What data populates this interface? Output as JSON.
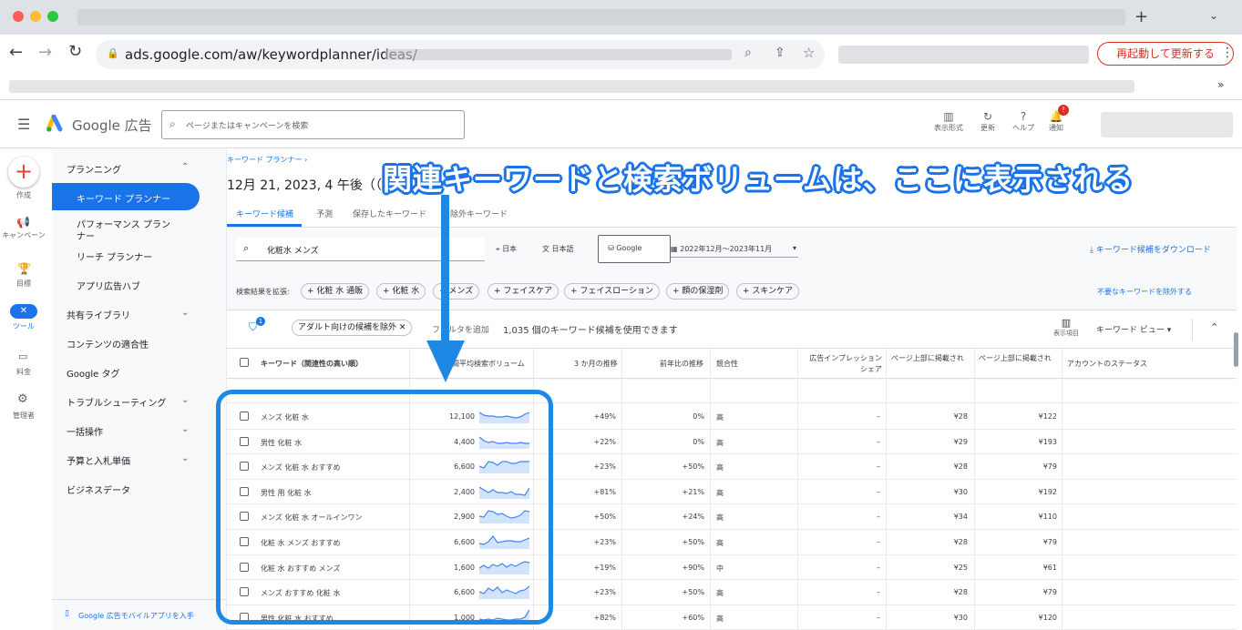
{
  "browser": {
    "url": "ads.google.com/aw/keywordplanner/ideas/",
    "restart_label": "再起動して更新する"
  },
  "app": {
    "brand": "Google 広告",
    "search_placeholder": "ページまたはキャンペーンを検索",
    "header_actions": [
      "表示形式",
      "更新",
      "ヘルプ",
      "通知"
    ],
    "notification_badge": "!"
  },
  "rail": {
    "items": [
      "作成",
      "キャンペーン",
      "目標",
      "ツール",
      "料金",
      "管理者"
    ]
  },
  "sidebar": {
    "planning": "プランニング",
    "items": [
      "キーワード プランナー",
      "パフォーマンス プランナー",
      "リーチ プランナー",
      "アプリ広告ハブ"
    ],
    "sections": [
      "共有ライブラリ",
      "コンテンツの適合性",
      "Google タグ",
      "トラブルシューティング",
      "一括操作",
      "予算と入札単価",
      "ビジネスデータ"
    ],
    "mobile_app": "Google 広告モバイルアプリを入手"
  },
  "main": {
    "breadcrumb": "キーワード プランナー ›",
    "title": "12月 21, 2023, 4 午後（（G",
    "tabs": [
      "キーワード候補",
      "予測",
      "保存したキーワード",
      "除外キーワード"
    ],
    "query": "化粧水 メンズ",
    "location": "日本",
    "language": "日本語",
    "network": "Google",
    "date_range": "2022年12月～2023年11月",
    "download": "キーワード候補をダウンロード",
    "expand_label": "検索結果を拡張:",
    "expand_chips": [
      "化粧 水 通販",
      "化粧 水",
      "メンズ",
      "フェイスケア",
      "フェイスローション",
      "顔の保湿剤",
      "スキンケア"
    ],
    "exclude_link": "不要なキーワードを除外する",
    "filter_badge": "1",
    "filter_chip": "アダルト向けの候補を除外",
    "add_filter": "フィルタを追加",
    "result_count": "1,035 個のキーワード候補を使用できます",
    "columns_label": "表示項目",
    "view_label": "キーワード ビュー"
  },
  "table": {
    "headers": [
      "キーワード（関連性の高い順）",
      "月間平均検索ボリューム",
      "3 か月の推移",
      "前年比の推移",
      "競合性",
      "広告インプレッション シェア",
      "ページ上部に掲載され",
      "ページ上部に掲載され",
      "アカウントのステータス"
    ],
    "rows": [
      {
        "kw": "メンズ 化粧 水",
        "vol": "12,100",
        "m3": "+49%",
        "yoy": "0%",
        "comp": "高",
        "imp": "–",
        "low": "¥28",
        "high": "¥122"
      },
      {
        "kw": "男性 化粧 水",
        "vol": "4,400",
        "m3": "+22%",
        "yoy": "0%",
        "comp": "高",
        "imp": "–",
        "low": "¥29",
        "high": "¥193"
      },
      {
        "kw": "メンズ 化粧 水 おすすめ",
        "vol": "6,600",
        "m3": "+23%",
        "yoy": "+50%",
        "comp": "高",
        "imp": "–",
        "low": "¥28",
        "high": "¥79"
      },
      {
        "kw": "男性 用 化粧 水",
        "vol": "2,400",
        "m3": "+81%",
        "yoy": "+21%",
        "comp": "高",
        "imp": "–",
        "low": "¥30",
        "high": "¥192"
      },
      {
        "kw": "メンズ 化粧 水 オールインワン",
        "vol": "2,900",
        "m3": "+50%",
        "yoy": "+24%",
        "comp": "高",
        "imp": "–",
        "low": "¥34",
        "high": "¥110"
      },
      {
        "kw": "化粧 水 メンズ おすすめ",
        "vol": "6,600",
        "m3": "+23%",
        "yoy": "+50%",
        "comp": "高",
        "imp": "–",
        "low": "¥28",
        "high": "¥79"
      },
      {
        "kw": "化粧 水 おすすめ メンズ",
        "vol": "1,600",
        "m3": "+19%",
        "yoy": "+90%",
        "comp": "中",
        "imp": "–",
        "low": "¥25",
        "high": "¥61"
      },
      {
        "kw": "メンズ おすすめ 化粧 水",
        "vol": "6,600",
        "m3": "+23%",
        "yoy": "+50%",
        "comp": "高",
        "imp": "–",
        "low": "¥28",
        "high": "¥79"
      },
      {
        "kw": "男性 化粧 水 おすすめ",
        "vol": "1,000",
        "m3": "+82%",
        "yoy": "+60%",
        "comp": "高",
        "imp": "–",
        "low": "¥30",
        "high": "¥120"
      }
    ]
  },
  "annotation": "関連キーワードと検索ボリュームは、ここに表示される",
  "colors": {
    "accent": "#1a73e8",
    "annotation": "#1e88e5",
    "restart": "#d93025"
  }
}
